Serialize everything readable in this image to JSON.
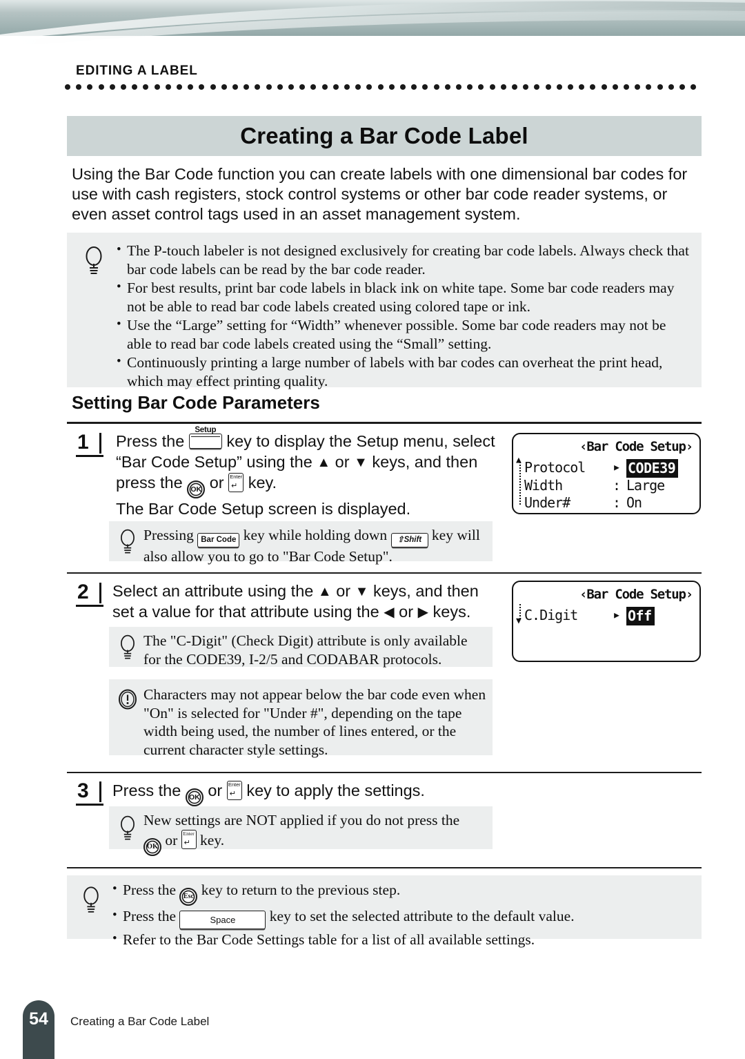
{
  "header": {
    "running_head": "EDITING A LABEL",
    "chapter_title": "Creating a Bar Code Label"
  },
  "intro": {
    "paragraph": "Using the Bar Code function you can create labels with one dimensional bar codes for use with cash registers, stock control systems or other bar code reader systems, or even asset control tags used in an asset management system."
  },
  "top_notes": {
    "icon": "lightbulb-icon",
    "items": [
      "The P-touch labeler is not designed exclusively for creating bar code labels. Always check that bar code labels can be read by the bar code reader.",
      "For best results, print bar code labels in black ink on white tape. Some bar code readers may not be able to read bar code labels created using colored tape or ink.",
      "Use the “Large” setting for “Width” whenever possible. Some bar code readers may not be able to read bar code labels created using the “Small” setting.",
      "Continuously printing a large number of labels with bar codes can overheat the print head, which may effect printing quality."
    ]
  },
  "section": {
    "heading": "Setting Bar Code Parameters"
  },
  "steps": [
    {
      "number": "1",
      "line1_a": "Press the",
      "key_setup": "Setup",
      "line1_b": "key to display the Setup menu, select",
      "line2_a": "“Bar Code Setup” using the",
      "arrow_up": "▲",
      "or": "or",
      "arrow_down": "▼",
      "line2_b": "keys, and then",
      "line3_a": "press the",
      "key_ok": "OK",
      "key_enter_label": "Enter",
      "line3_b": "key.",
      "line4": "The Bar Code Setup screen is displayed."
    },
    {
      "number": "2",
      "line1_a": "Select an attribute using the",
      "arrow_up": "▲",
      "or": "or",
      "arrow_down": "▼",
      "line1_b": "keys, and then",
      "line2_a": "set a value for that attribute using the",
      "arrow_left": "◀",
      "arrow_right": "▶",
      "line2_b": "keys."
    },
    {
      "number": "3",
      "line1_a": "Press the",
      "key_ok": "OK",
      "key_enter_label": "Enter",
      "or": "or",
      "line1_b": "key to apply the settings."
    }
  ],
  "note_step1": {
    "icon": "lightbulb-icon",
    "line1_a": "Pressing",
    "key_barcode": "Bar Code",
    "line1_b": "key while holding down",
    "key_shift": "⇧Shift",
    "line1_c": "key will",
    "line2": "also allow you to go to  \"Bar Code Setup\"."
  },
  "note_step2": {
    "icon": "lightbulb-icon",
    "text": "The \"C-Digit\" (Check Digit) attribute is only available for the CODE39, I-2/5 and CODABAR protocols."
  },
  "warning_step2": {
    "icon": "exclamation-icon",
    "text": "Characters may not appear below the bar code even when \"On\" is selected for \"Under #\", depending on the tape width being used, the number of lines entered, or the current character style settings."
  },
  "note_step3": {
    "icon": "lightbulb-icon",
    "line1": "New settings are NOT applied if you do not press the",
    "key_ok": "OK",
    "key_enter_label": "Enter",
    "or": "or",
    "line2_b": "key."
  },
  "bottom_notes": {
    "icon": "lightbulb-icon",
    "item1_a": "Press the",
    "key_esc": "Esc",
    "item1_b": "key to return to the previous step.",
    "item2_a": "Press the",
    "key_space": "Space",
    "item2_b": "key to set the selected attribute to the default value.",
    "item3": "Refer to the Bar Code Settings table for a list of all available settings."
  },
  "lcd_screens": [
    {
      "name": "bar-code-setup-protocol",
      "title": "‹Bar Code Setup›",
      "scroll_indicator": "up",
      "rows": [
        {
          "label": "Protocol",
          "sep": ":",
          "value": "CODE39",
          "selected": true
        },
        {
          "label": "Width",
          "sep": ":",
          "value": "Large",
          "selected": false
        },
        {
          "label": "Under#",
          "sep": ":",
          "value": "On",
          "selected": false
        }
      ]
    },
    {
      "name": "bar-code-setup-cdigit",
      "title": "‹Bar Code Setup›",
      "scroll_indicator": "down",
      "rows": [
        {
          "label": "C.Digit",
          "sep": ":",
          "value": "Off",
          "selected": true
        }
      ]
    }
  ],
  "footer": {
    "page_number": "54",
    "caption": "Creating a Bar Code Label"
  },
  "colors": {
    "banner": "#93a8a8",
    "title_bar": "#ccd5d5",
    "note_bg": "#eceeee",
    "footer_badge": "#3d4a4d",
    "ink": "#111111"
  }
}
